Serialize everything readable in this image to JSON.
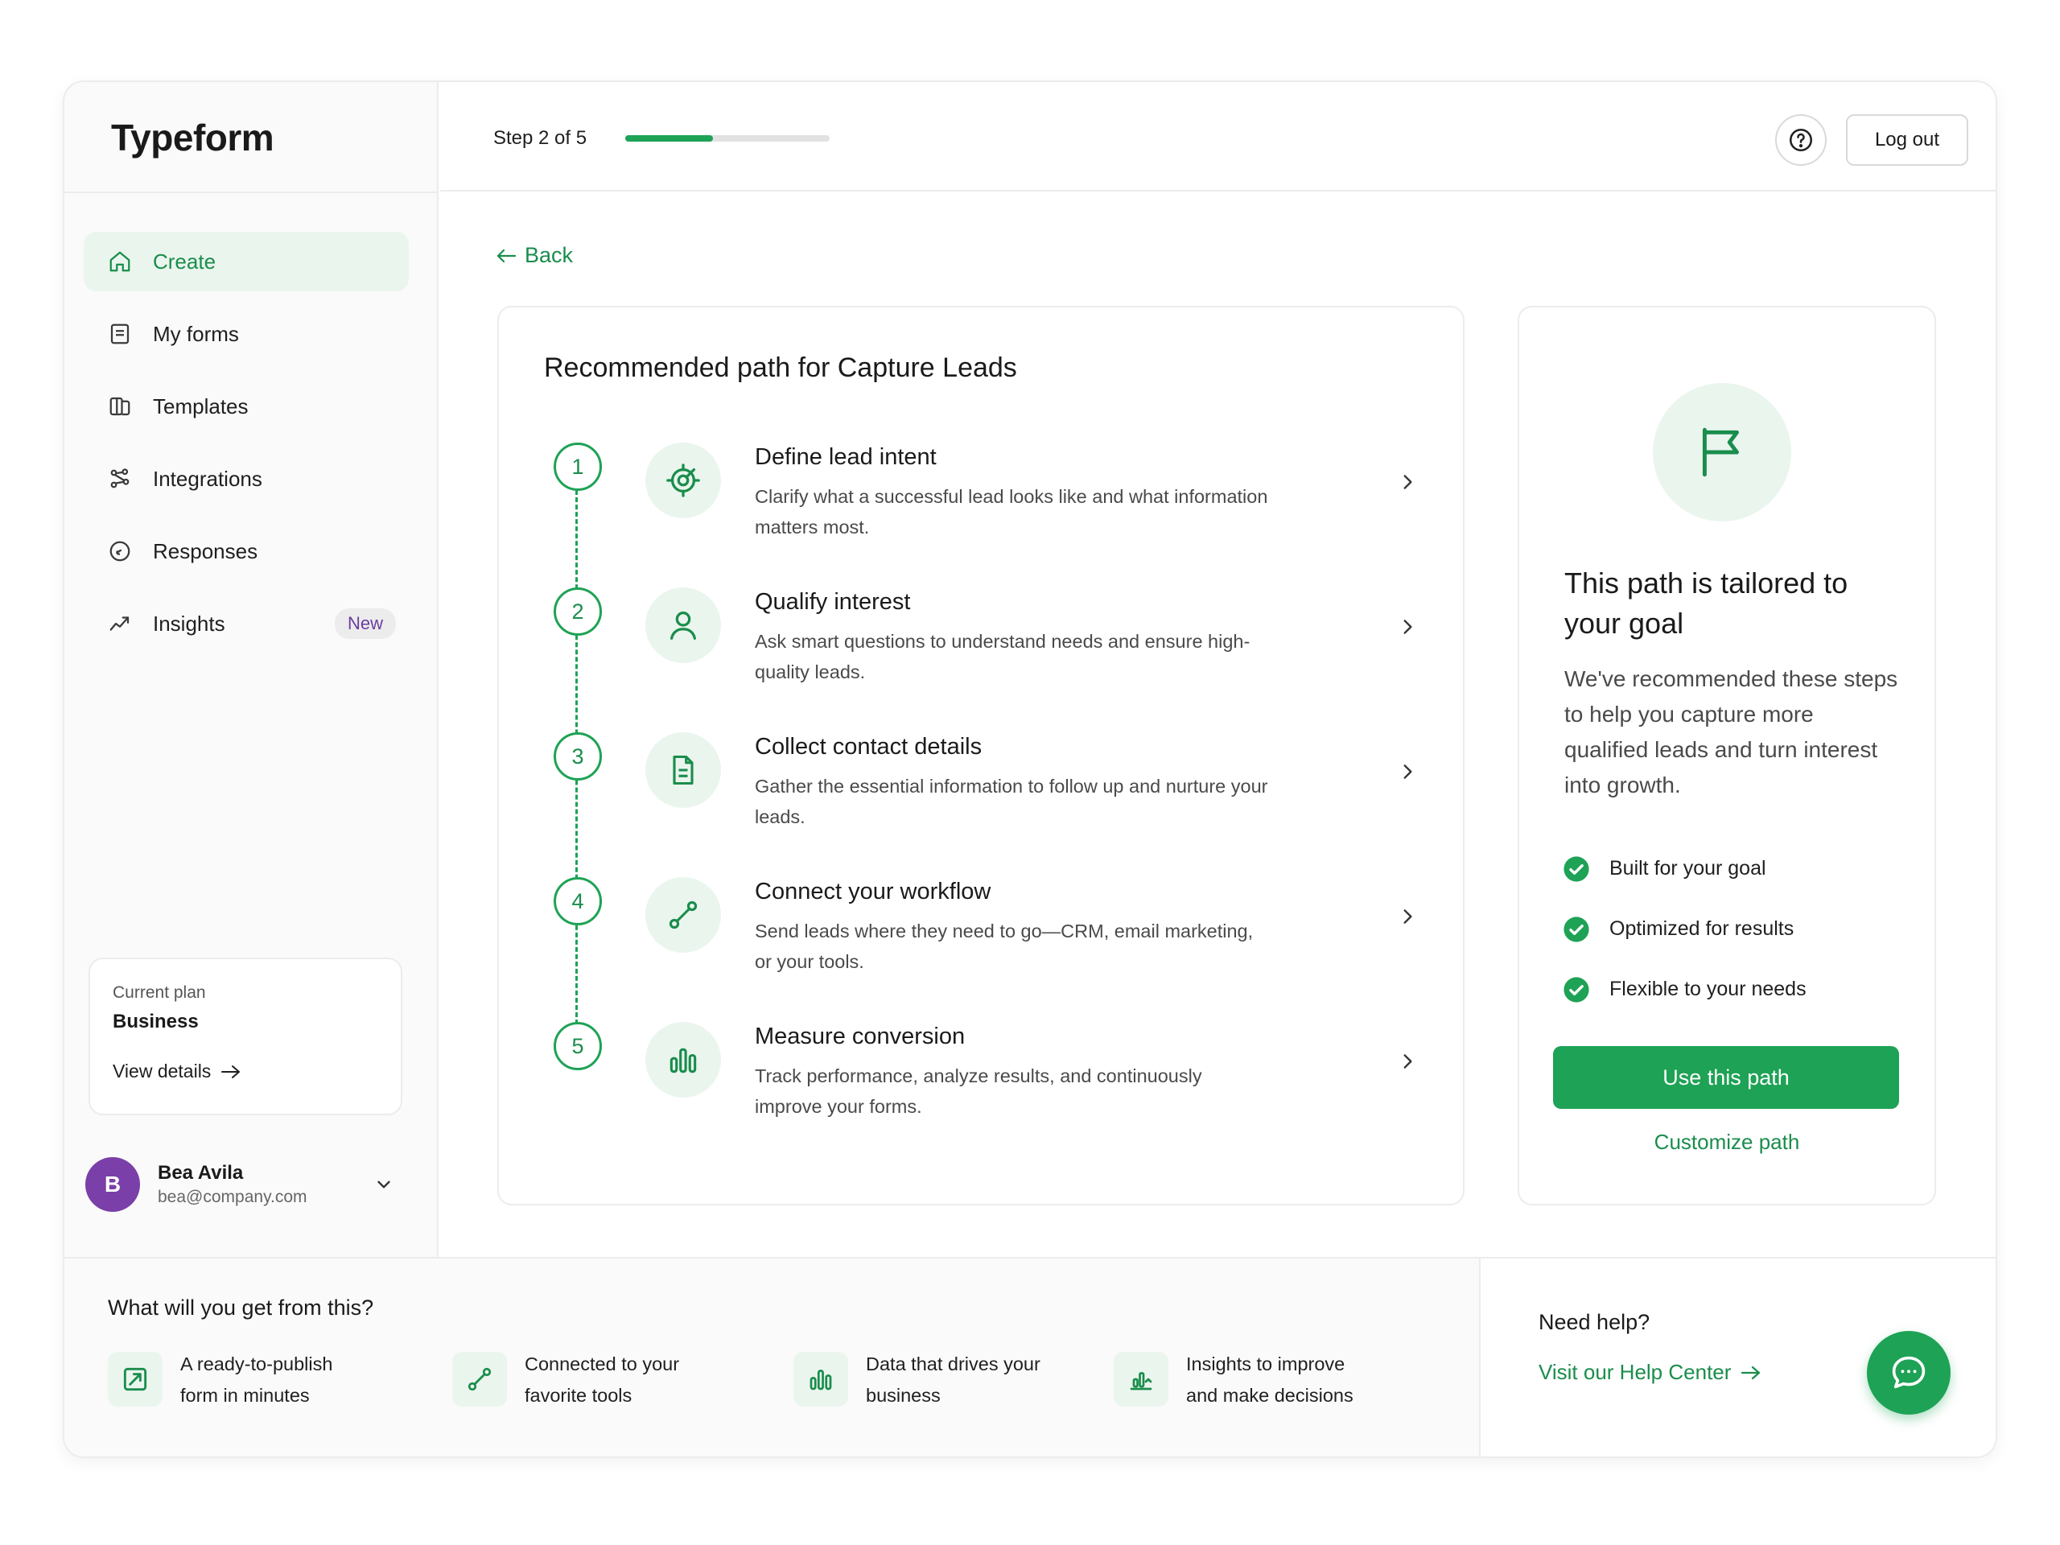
{
  "app": {
    "logo": "Typeform"
  },
  "header": {
    "step_label": "Step 2 of 5",
    "progress_fraction": 0.43,
    "help_icon": "question-circle-icon",
    "logout_label": "Log out"
  },
  "sidebar": {
    "items": [
      {
        "label": "Create",
        "icon": "home-icon",
        "active": true
      },
      {
        "label": "My forms",
        "icon": "document-icon"
      },
      {
        "label": "Templates",
        "icon": "templates-icon"
      },
      {
        "label": "Integrations",
        "icon": "integrations-icon"
      },
      {
        "label": "Responses",
        "icon": "chat-bubble-icon"
      },
      {
        "label": "Insights",
        "icon": "trend-icon",
        "badge": "New"
      }
    ],
    "plan": {
      "label": "Current plan",
      "name": "Business",
      "link": "View details"
    },
    "user": {
      "initial": "B",
      "name": "Bea Avila",
      "email": "bea@company.com"
    }
  },
  "main": {
    "back_label": "Back",
    "path": {
      "title": "Recommended path for Capture Leads",
      "steps": [
        {
          "number": "1",
          "title": "Define lead intent",
          "desc": "Clarify what a successful lead looks like and what information matters most.",
          "icon": "target-icon"
        },
        {
          "number": "2",
          "title": "Qualify interest",
          "desc": "Ask smart questions to understand needs and ensure high-quality leads.",
          "icon": "user-icon"
        },
        {
          "number": "3",
          "title": "Collect contact details",
          "desc": "Gather the essential information to follow up and nurture your leads.",
          "icon": "document-icon"
        },
        {
          "number": "4",
          "title": "Connect your workflow",
          "desc": "Send leads where they need to go—CRM, email marketing, or your tools.",
          "icon": "link-nodes-icon"
        },
        {
          "number": "5",
          "title": "Measure conversion",
          "desc": "Track performance, analyze results, and continuously improve your forms.",
          "icon": "bar-chart-icon"
        }
      ]
    },
    "side": {
      "title": "This path is tailored to your goal",
      "desc": "We've recommended these steps to help you capture more qualified leads and turn interest into growth.",
      "checks": [
        "Built for your goal",
        "Optimized for results",
        "Flexible to your needs"
      ],
      "use_button": "Use this path",
      "customize_link": "Customize path"
    }
  },
  "bottom": {
    "title": "What will you get from this?",
    "benefits": [
      {
        "text": "A ready-to-publish form in minutes",
        "icon": "form-check-icon"
      },
      {
        "text": "Connected to your favorite tools",
        "icon": "link-nodes-icon"
      },
      {
        "text": "Data that drives your business",
        "icon": "bar-chart-icon"
      },
      {
        "text": "Insights to improve and make decisions",
        "icon": "chart-up-icon"
      }
    ],
    "help": {
      "title": "Need help?",
      "link": "Visit our Help Center",
      "chat_icon": "chat-icon"
    }
  },
  "colors": {
    "accent": "#1ea255",
    "accent_dark": "#1a8d4c",
    "accent_light": "#eaf5ee",
    "avatar": "#7a3fa8",
    "badge_text": "#6a3ea1"
  }
}
